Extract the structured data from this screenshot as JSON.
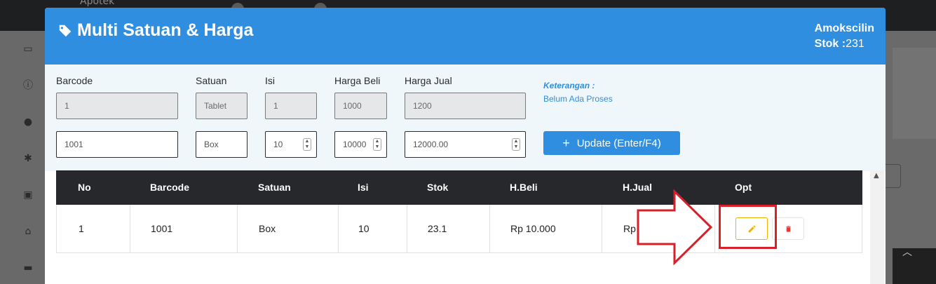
{
  "background": {
    "app_name": "Apotek"
  },
  "modal": {
    "title": "Multi Satuan & Harga",
    "product_name": "Amokscilin",
    "stok_label": "Stok :",
    "stok_value": "231"
  },
  "form": {
    "labels": {
      "barcode": "Barcode",
      "satuan": "Satuan",
      "isi": "Isi",
      "harga_beli": "Harga Beli",
      "harga_jual": "Harga Jual"
    },
    "base_row": {
      "barcode": "1",
      "satuan": "Tablet",
      "isi": "1",
      "harga_beli": "1000",
      "harga_jual": "1200"
    },
    "edit_row": {
      "barcode": "1001",
      "satuan": "Box",
      "isi": "10",
      "harga_beli": "10000",
      "harga_jual": "12000.00"
    },
    "keterangan_label": "Keterangan :",
    "keterangan_value": "Belum Ada Proses",
    "update_button": "Update (Enter/F4)"
  },
  "table": {
    "headers": [
      "No",
      "Barcode",
      "Satuan",
      "Isi",
      "Stok",
      "H.Beli",
      "H.Jual",
      "Opt"
    ],
    "rows": [
      {
        "no": "1",
        "barcode": "1001",
        "satuan": "Box",
        "isi": "10",
        "stok": "23.1",
        "h_beli": "Rp 10.000",
        "h_jual": "Rp 12.000"
      }
    ]
  },
  "colors": {
    "header_blue": "#2f8ee0",
    "table_header": "#26282b",
    "edit_yellow": "#f0b100",
    "delete_red": "#e53935",
    "annotation_red": "#d81f2a"
  },
  "icons": {
    "title": "tag-icon",
    "update": "plus-icon",
    "edit": "pencil-icon",
    "delete": "trash-icon"
  }
}
